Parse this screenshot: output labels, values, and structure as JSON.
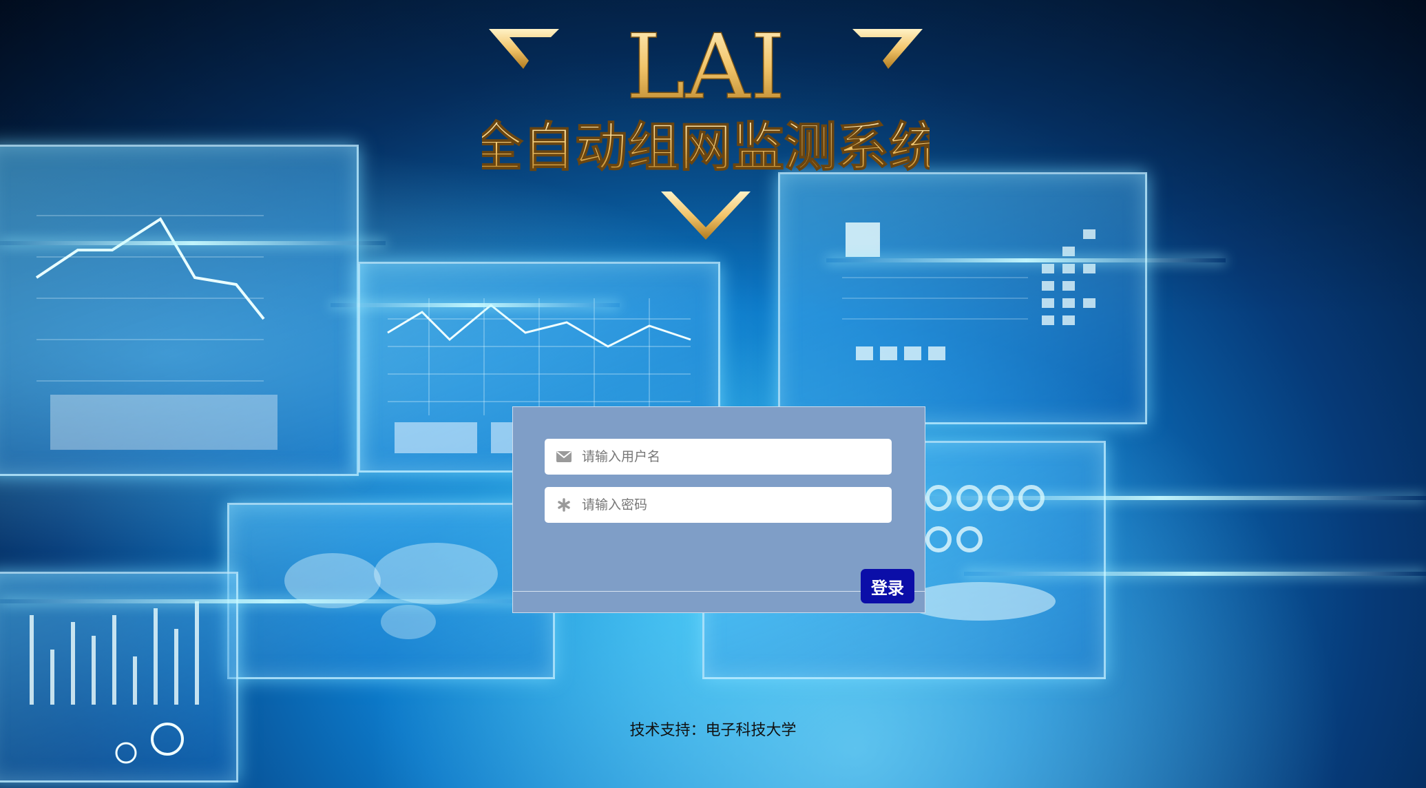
{
  "header": {
    "logo_text": "LAI",
    "system_title": "全自动组网监测系统"
  },
  "login": {
    "username_placeholder": "请输入用户名",
    "password_placeholder": "请输入密码",
    "login_label": "登录"
  },
  "footer": {
    "support_text": "技术支持：电子科技大学"
  },
  "colors": {
    "card_bg": "#7f9ec7",
    "button_bg": "#0b0ea8",
    "gold": "#f2c56b"
  },
  "icons": {
    "username": "envelope-icon",
    "password": "asterisk-icon"
  }
}
